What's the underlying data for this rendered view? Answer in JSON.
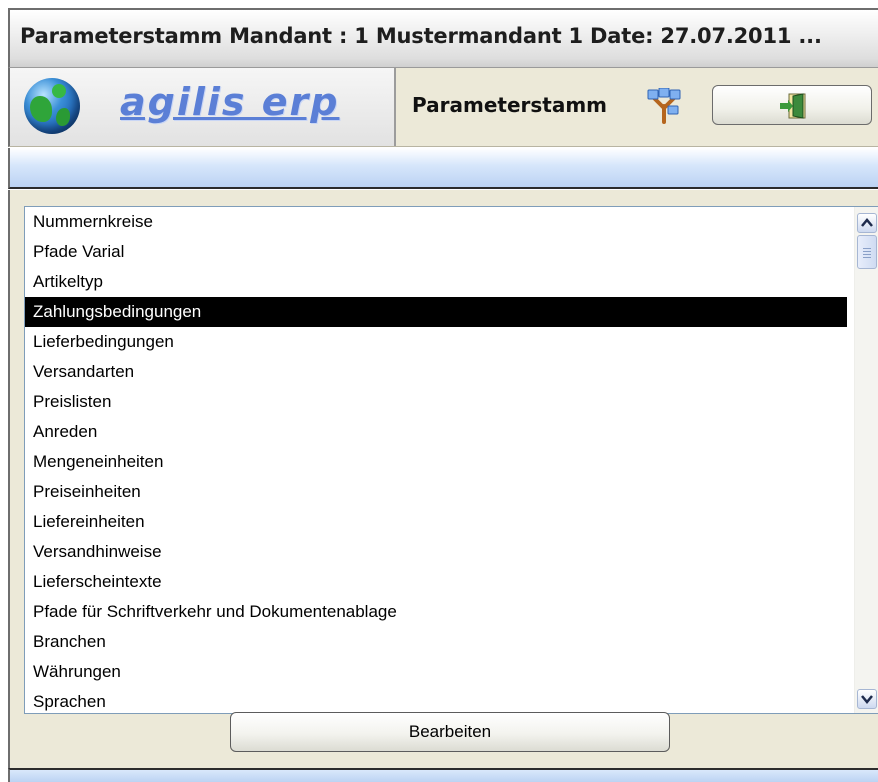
{
  "window": {
    "title": "Parameterstamm Mandant : 1 Mustermandant 1 Date: 27.07.2011 ..."
  },
  "header": {
    "brand": "agilis erp",
    "section_title": "Parameterstamm",
    "icons": {
      "logo": "globe-icon",
      "tree": "tree-icon",
      "exit": "exit-door-icon"
    }
  },
  "list": {
    "items": [
      "Nummernkreise",
      "Pfade Varial",
      "Artikeltyp",
      "Zahlungsbedingungen",
      "Lieferbedingungen",
      "Versandarten",
      "Preislisten",
      "Anreden",
      "Mengeneinheiten",
      "Preiseinheiten",
      "Liefereinheiten",
      "Versandhinweise",
      "Lieferscheintexte",
      "Pfade für Schriftverkehr und Dokumentenablage",
      "Branchen",
      "Währungen",
      "Sprachen"
    ],
    "selected_index": 3
  },
  "actions": {
    "edit_label": "Bearbeiten"
  },
  "colors": {
    "brand": "#5b7fd6",
    "selection_bg": "#000000",
    "selection_fg": "#ffffff",
    "panel_bg": "#ece9d8"
  }
}
